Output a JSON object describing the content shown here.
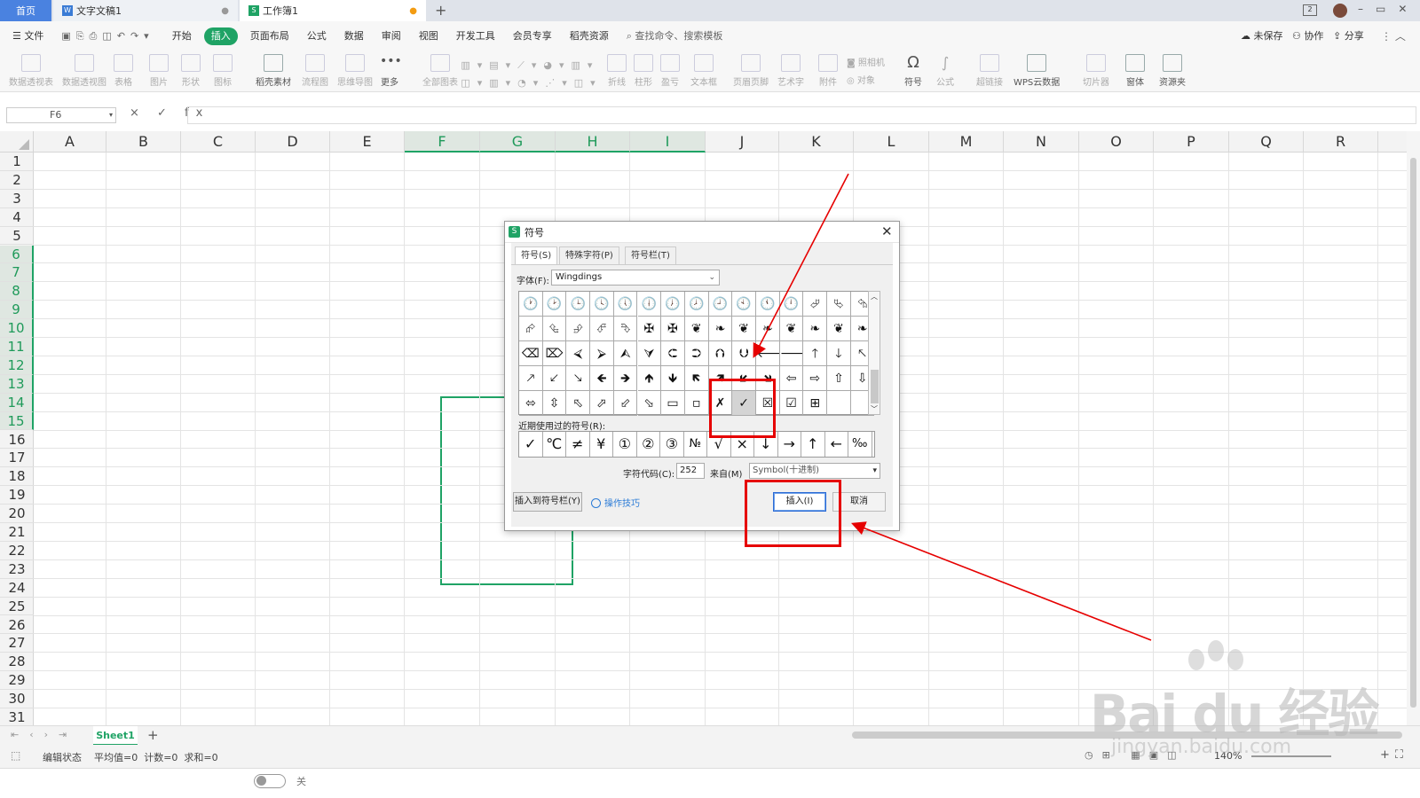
{
  "tabs": [
    {
      "label": "首页",
      "active": true
    },
    {
      "label": "文字文稿1"
    },
    {
      "label": "工作簿1"
    }
  ],
  "menu": [
    "文件",
    "开始",
    "插入",
    "页面布局",
    "公式",
    "数据",
    "审阅",
    "视图",
    "开发工具",
    "会员专享",
    "稻壳资源"
  ],
  "menu_active": "插入",
  "search_placeholder": "查找命令、搜索模板",
  "header_right": [
    "未保存",
    "协作",
    "分享"
  ],
  "ribbon": [
    "数据透视表",
    "数据透视图",
    "表格",
    "图片",
    "形状",
    "图标",
    "稻壳素材",
    "流程图",
    "思维导图",
    "更多",
    "全部图表",
    "折线",
    "柱形",
    "盈亏",
    "文本框",
    "页眉页脚",
    "艺术字",
    "附件",
    "照相机",
    "对象",
    "符号",
    "公式",
    "超链接",
    "WPS云数据",
    "切片器",
    "窗体",
    "资源夹"
  ],
  "formula_bar": {
    "namebox": "F6",
    "icons": "×  ✓  fx",
    "value": ""
  },
  "columns": [
    "A",
    "B",
    "C",
    "D",
    "E",
    "F",
    "G",
    "H",
    "I",
    "J",
    "K",
    "L",
    "M",
    "N",
    "O",
    "P",
    "Q",
    "R"
  ],
  "selected_columns": [
    "F",
    "G",
    "H",
    "I"
  ],
  "rows": [
    "1",
    "2",
    "3",
    "4",
    "5",
    "6",
    "7",
    "8",
    "9",
    "10",
    "11",
    "12",
    "13",
    "14",
    "15",
    "16",
    "17",
    "18",
    "19",
    "20",
    "21",
    "22",
    "23",
    "24",
    "25",
    "26",
    "27",
    "28",
    "29",
    "30",
    "31"
  ],
  "selected_rows": [
    "6",
    "7",
    "8",
    "9",
    "10",
    "11",
    "12",
    "13",
    "14",
    "15"
  ],
  "sheet": {
    "name": "Sheet1",
    "add": "+"
  },
  "status": {
    "mode": "编辑状态",
    "stats": "平均值=0  计数=0  求和=0",
    "zoom": "140%",
    "toggle_label": "关"
  },
  "dialog": {
    "title": "符号",
    "tabs": [
      "符号(S)",
      "特殊字符(P)",
      "符号栏(T)"
    ],
    "font_label": "字体(F):",
    "font_value": "Wingdings",
    "symbol_rows": [
      [
        "🕐",
        "🕑",
        "🕒",
        "🕓",
        "🕔",
        "🕕",
        "🕖",
        "🕗",
        "🕘",
        "🕙",
        "🕚",
        "🕛",
        "⮰",
        "⮱",
        "⮲"
      ],
      [
        "⮳",
        "⮴",
        "⮵",
        "⮶",
        "⮷",
        "✠",
        "✠",
        "❦",
        "❧",
        "❦",
        "❧",
        "❦",
        "❧",
        "❦",
        "❧"
      ],
      [
        "⌫",
        "⌦",
        "⮘",
        "⮚",
        "⮙",
        "⮛",
        "⮈",
        "⮊",
        "⮉",
        "⮋",
        "🡐",
        "🡒",
        "🡑",
        "🡓",
        "🡔"
      ],
      [
        "🡕",
        "🡗",
        "🡖",
        "🡸",
        "🡺",
        "🡹",
        "🡻",
        "🡼",
        "🡽",
        "🡿",
        "🡾",
        "⇦",
        "⇨",
        "⇧",
        "⇩"
      ],
      [
        "⬄",
        "⇳",
        "⬁",
        "⬀",
        "⬃",
        "⬂",
        "▭",
        "▫",
        "✗",
        "✓",
        "☒",
        "☑",
        "⊞",
        "",
        ""
      ]
    ],
    "selected_symbol": "✓",
    "recent_label": "近期使用过的符号(R):",
    "recent": [
      "✓",
      "℃",
      "≠",
      "¥",
      "①",
      "②",
      "③",
      "№",
      "√",
      "×",
      "↓",
      "→",
      "↑",
      "←",
      "‰"
    ],
    "code_label": "字符代码(C):",
    "code_value": "252",
    "from_label": "来自(M)",
    "from_value": "Symbol(十进制)",
    "btn_insert_bar": "插入到符号栏(Y)",
    "tips": "操作技巧",
    "btn_insert": "插入(I)",
    "btn_cancel": "取消"
  },
  "watermark": {
    "main": "Bai du 经验",
    "sub": "jingyan.baidu.com"
  },
  "colors": {
    "accent": "#1fa365",
    "annotation": "#e60000"
  }
}
